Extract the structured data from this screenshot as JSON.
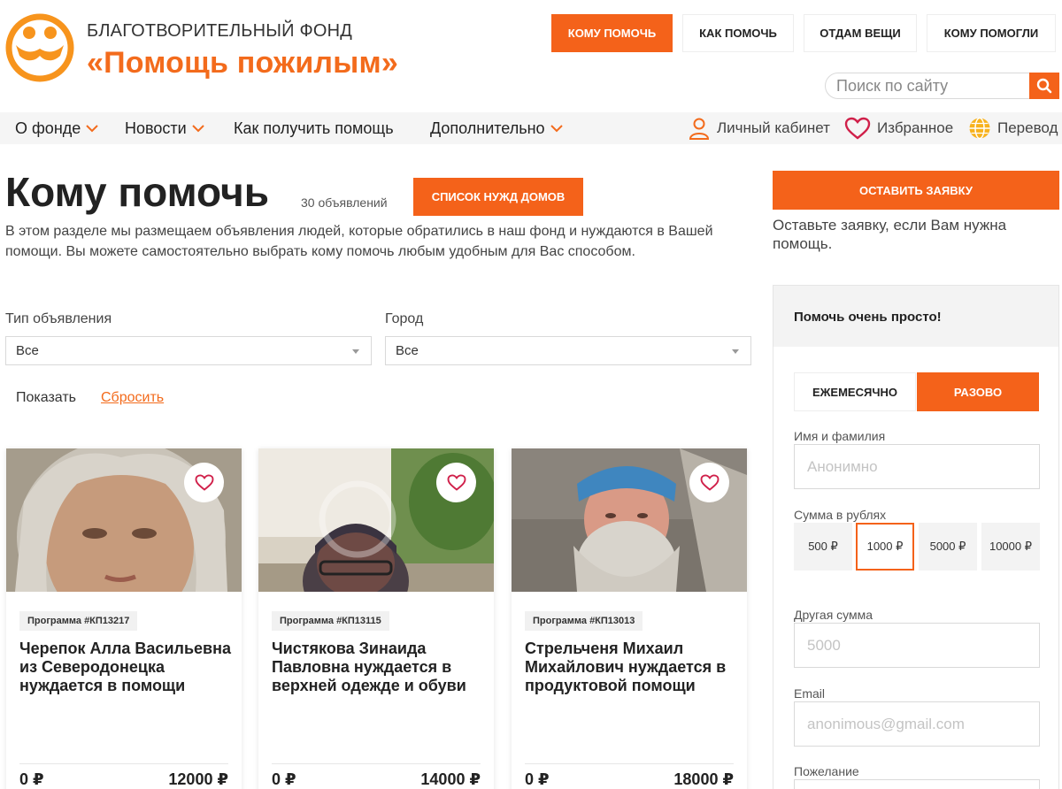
{
  "brand": {
    "subtitle": "БЛАГОТВОРИТЕЛЬНЫЙ ФОНД",
    "title": "«Помощь пожилым»",
    "accent_color": "#f4621a"
  },
  "top_nav": [
    {
      "label": "Кому помочь",
      "active": true
    },
    {
      "label": "Как помочь",
      "active": false
    },
    {
      "label": "Отдам вещи",
      "active": false
    },
    {
      "label": "Кому помогли",
      "active": false
    }
  ],
  "search": {
    "placeholder": "Поиск по сайту",
    "icon": "search-icon"
  },
  "menu": {
    "items": [
      {
        "label": "О фонде",
        "dropdown": true
      },
      {
        "label": "Новости",
        "dropdown": true
      },
      {
        "label": "Как получить помощь",
        "dropdown": false
      },
      {
        "label": "Дополнительно",
        "dropdown": true
      }
    ],
    "account": {
      "label": "Личный кабинет",
      "icon": "user-icon"
    },
    "favorites": {
      "label": "Избранное",
      "icon": "heart-icon"
    },
    "translate": {
      "label": "Перевод",
      "icon": "globe-icon"
    }
  },
  "main": {
    "title": "Кому помочь",
    "count": "30 объявлений",
    "list_button": "Список нужд домов",
    "intro": "В этом разделе мы размещаем объявления людей, которые обратились в наш фонд и нуждаются в Вашей помощи. Вы можете самостоятельно выбрать кому помочь любым удобным для Вас способом."
  },
  "filters": {
    "type_label": "Тип объявления",
    "type_value": "Все",
    "city_label": "Город",
    "city_value": "Все",
    "show": "Показать",
    "reset": "Сбросить"
  },
  "cards": [
    {
      "badge": "Программа #КП13217",
      "title": "Черепок Алла Васильевна из Северодонецка нуждается в помощи",
      "collected": "0 ₽",
      "goal": "12000 ₽"
    },
    {
      "badge": "Программа #КП13115",
      "title": "Чистякова Зинаида Павловна нуждается в верхней одежде и обуви",
      "collected": "0 ₽",
      "goal": "14000 ₽"
    },
    {
      "badge": "Программа #КП13013",
      "title": "Стрельченя Михаил Михайлович нуждается в продуктовой помощи",
      "collected": "0 ₽",
      "goal": "18000 ₽"
    }
  ],
  "sidebar": {
    "apply_button": "Оставить заявку",
    "apply_note": "Оставьте заявку, если Вам нужна помощь.",
    "donate": {
      "heading": "Помочь очень просто!",
      "tabs": [
        {
          "label": "Ежемесячно",
          "active": false
        },
        {
          "label": "Разово",
          "active": true
        }
      ],
      "name_label": "Имя и фамилия",
      "name_placeholder": "Анонимно",
      "amount_label": "Сумма в рублях",
      "amounts": [
        {
          "label": "500 ₽",
          "selected": false
        },
        {
          "label": "1000 ₽",
          "selected": true
        },
        {
          "label": "5000 ₽",
          "selected": false
        },
        {
          "label": "10000 ₽",
          "selected": false
        }
      ],
      "other_label": "Другая сумма",
      "other_placeholder": "5000",
      "email_label": "Email",
      "email_placeholder": "anonimous@gmail.com",
      "wish_label": "Пожелание"
    }
  }
}
